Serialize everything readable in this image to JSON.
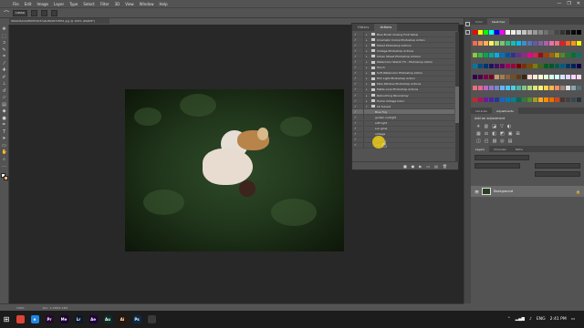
{
  "app": {
    "logo": "Ps",
    "menu": [
      "File",
      "Edit",
      "Image",
      "Layer",
      "Type",
      "Select",
      "Filter",
      "3D",
      "View",
      "Window",
      "Help"
    ],
    "window_controls": [
      "—",
      "❐",
      "✕"
    ]
  },
  "options_bar": {
    "tool_icon": "lasso-icon",
    "mode_value": "Lasso"
  },
  "document": {
    "tab_title": "96b9c8e1b0f84553037e6c8b9671f651.jpg @ 100% (RGB/8*)",
    "status_zoom": "100%",
    "status_doc": "Doc: 1.13M/1.13M"
  },
  "tools": [
    "move",
    "marquee",
    "lasso",
    "quick-select",
    "crop",
    "eyedropper",
    "healing",
    "brush",
    "stamp",
    "history-brush",
    "eraser",
    "gradient",
    "blur",
    "dodge",
    "pen",
    "type",
    "path-select",
    "shape",
    "hand",
    "zoom",
    "more"
  ],
  "actions_panel": {
    "tabs": [
      "History",
      "Actions"
    ],
    "active_tab": "Actions",
    "rows": [
      {
        "label": "Blue Brush Closing Font Setup",
        "kind": "set",
        "checked": true
      },
      {
        "label": "Cinematic Colors Photoshop Action",
        "kind": "set",
        "checked": true
      },
      {
        "label": "Faded Photoshop Actions",
        "kind": "set",
        "checked": true
      },
      {
        "label": "Vintage Photoshop Actions",
        "kind": "set",
        "checked": true
      },
      {
        "label": "Urban Street Photoshop Actions",
        "kind": "set",
        "checked": true
      },
      {
        "label": "Watercolor Sketch FX - Photoshop Action",
        "kind": "set",
        "checked": true
      },
      {
        "label": "Touch",
        "kind": "set",
        "checked": true
      },
      {
        "label": "Soft Watercolor Photoshop Action",
        "kind": "set",
        "checked": true
      },
      {
        "label": "Film Light Photoshop Action",
        "kind": "set",
        "checked": true
      },
      {
        "label": "Fake Window Photoshop Actions",
        "kind": "set",
        "checked": true
      },
      {
        "label": "Matte Look Photoshop Actions",
        "kind": "set",
        "checked": true
      },
      {
        "label": "Retouching Panoramay",
        "kind": "set",
        "checked": true
      },
      {
        "label": "Home Vintage Color",
        "kind": "set",
        "checked": true
      },
      {
        "label": "LR Sunset",
        "kind": "set-open",
        "checked": true
      },
      {
        "label": "Blue Fog",
        "kind": "action",
        "checked": true,
        "selected": true
      },
      {
        "label": "golden sunlight",
        "kind": "action",
        "checked": true
      },
      {
        "label": "soft light",
        "kind": "action",
        "checked": true
      },
      {
        "label": "sun glow",
        "kind": "action",
        "checked": true
      },
      {
        "label": "vintage",
        "kind": "action",
        "checked": true
      },
      {
        "label": "sharp",
        "kind": "action",
        "checked": true
      },
      {
        "label": "play all",
        "kind": "action",
        "checked": true
      }
    ],
    "footer_buttons": [
      "■",
      "●",
      "▶",
      "▭",
      "▤",
      "🗑"
    ]
  },
  "right_panels": {
    "color_tabs": [
      "Color",
      "Swatches"
    ],
    "color_active": "Swatches",
    "swatch_colors": [
      "#ff0000",
      "#ffff00",
      "#00ff00",
      "#00ffff",
      "#0000ff",
      "#ff00ff",
      "#ffffff",
      "#ebebeb",
      "#d6d6d6",
      "#c2c2c2",
      "#adadad",
      "#999999",
      "#858585",
      "#707070",
      "#5c5c5c",
      "#474747",
      "#333333",
      "#1f1f1f",
      "#0a0a0a",
      "#000000",
      "#f26c4f",
      "#f68e55",
      "#fbaf5c",
      "#fff467",
      "#acd372",
      "#7cc576",
      "#3bb878",
      "#1abbb4",
      "#00bff3",
      "#438ccb",
      "#5574b9",
      "#605ca8",
      "#855fa8",
      "#a763a9",
      "#f06eaa",
      "#f26d7d",
      "#ed1c24",
      "#f26522",
      "#f7941d",
      "#fff200",
      "#8dc73f",
      "#39b54a",
      "#00a651",
      "#00a99d",
      "#00aeef",
      "#0072bc",
      "#0054a5",
      "#2e3192",
      "#662d91",
      "#92278f",
      "#ec008c",
      "#ed145b",
      "#9e0b0f",
      "#a0410d",
      "#a3620a",
      "#aba000",
      "#598527",
      "#1a7b30",
      "#007236",
      "#00746b",
      "#0076a3",
      "#004b80",
      "#003370",
      "#1b1464",
      "#440e62",
      "#630460",
      "#9e005d",
      "#9e0039",
      "#790000",
      "#7b2e00",
      "#7d4900",
      "#827b00",
      "#406618",
      "#005e20",
      "#005826",
      "#005952",
      "#005b7f",
      "#003663",
      "#002157",
      "#0d004c",
      "#32004b",
      "#4b0049",
      "#7b0046",
      "#7a0026",
      "#c69c6d",
      "#a67c52",
      "#8c6239",
      "#754c24",
      "#603913",
      "#3c2415",
      "#ffd5d5",
      "#ffe9d5",
      "#fffbd5",
      "#e6ffd5",
      "#d5ffe6",
      "#d5fbff",
      "#d5e6ff",
      "#e1d5ff",
      "#fbd5ff",
      "#ffd5eb",
      "#e57373",
      "#f06292",
      "#ba68c8",
      "#9575cd",
      "#7986cb",
      "#64b5f6",
      "#4fc3f7",
      "#4dd0e1",
      "#4db6ac",
      "#81c784",
      "#aed581",
      "#dce775",
      "#fff176",
      "#ffd54f",
      "#ffb74d",
      "#ff8a65",
      "#a1887f",
      "#e0e0e0",
      "#90a4ae",
      "#546e7a",
      "#c62828",
      "#ad1457",
      "#6a1b9a",
      "#4527a0",
      "#283593",
      "#1565c0",
      "#0277bd",
      "#00838f",
      "#00695c",
      "#2e7d32",
      "#558b2f",
      "#9e9d24",
      "#f9a825",
      "#ff8f00",
      "#ef6c00",
      "#d84315",
      "#4e342e",
      "#424242",
      "#37474f",
      "#263238"
    ],
    "adjust_tabs": [
      "Libraries",
      "Adjustments"
    ],
    "adjust_active": "Adjustments",
    "adjust_title": "Add an adjustment",
    "adjust_row1": [
      "☀",
      "▥",
      "◪",
      "▽",
      "◐"
    ],
    "adjust_row2": [
      "▦",
      "⚖",
      "◧",
      "◩",
      "▣",
      "⊞"
    ],
    "adjust_row3": [
      "◫",
      "◰",
      "▨",
      "◎",
      "▤"
    ],
    "layers_tabs": [
      "Layers",
      "Channels",
      "Paths"
    ],
    "layers_active": "Layers",
    "layer": {
      "name": "Background",
      "lock": "🔒",
      "eye": "👁"
    }
  },
  "taskbar": {
    "start": "⊞",
    "apps": [
      {
        "name": "chrome",
        "color": "#db4437",
        "label": ""
      },
      {
        "name": "edge",
        "color": "#1e88e5",
        "label": "e"
      },
      {
        "name": "premiere",
        "color": "#2a0634",
        "label": "Pr"
      },
      {
        "name": "media-encoder",
        "color": "#1f0033",
        "label": "Me"
      },
      {
        "name": "lightroom",
        "color": "#0a1a2e",
        "label": "Lr"
      },
      {
        "name": "after-effects",
        "color": "#1f0040",
        "label": "Ae"
      },
      {
        "name": "audition",
        "color": "#0a2e26",
        "label": "Au"
      },
      {
        "name": "illustrator",
        "color": "#2e1500",
        "label": "Ai"
      },
      {
        "name": "photoshop",
        "color": "#0b2a4a",
        "label": "Ps"
      },
      {
        "name": "camera",
        "color": "#3a3a3a",
        "label": ""
      }
    ],
    "tray_lang": "ENG",
    "time": "2:41 PM"
  }
}
